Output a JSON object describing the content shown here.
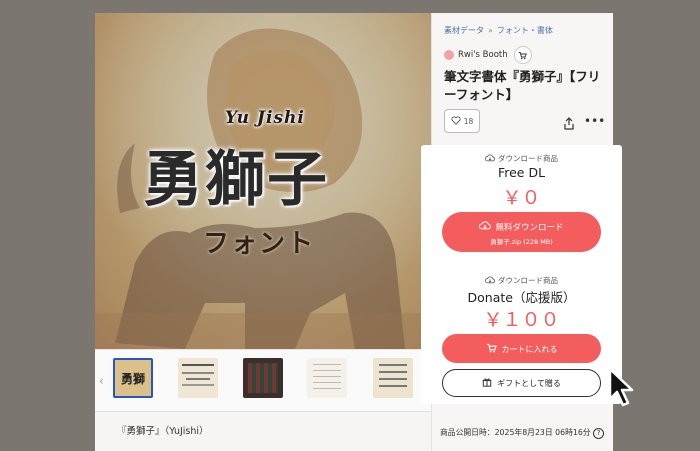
{
  "breadcrumb": {
    "category": "素材データ",
    "separator": "»",
    "subcategory": "フォント・書体"
  },
  "shop": {
    "name": "Rwi's Booth",
    "icon": "cart-icon"
  },
  "product": {
    "title": "筆文字書体『勇獅子』【フリーフォント】",
    "likes": "18",
    "hero": {
      "small_text": "Yu Jishi",
      "main_text": "勇獅子",
      "sub_text": "フォント"
    }
  },
  "plans": [
    {
      "type_label": "ダウンロード商品",
      "name": "Free DL",
      "price": "￥０",
      "button_label": "無料ダウンロード",
      "button_sub": "勇獅子.zip (228 MB)"
    },
    {
      "type_label": "ダウンロード商品",
      "name": "Donate（応援版）",
      "price": "￥１００",
      "button_label": "カートに入れる",
      "gift_label": "ギフトとして贈る"
    }
  ],
  "description": {
    "title": "『勇獅子』（YuJishi）"
  },
  "meta": {
    "published": "商品公開日時：2025年8月23日 06時16分"
  },
  "colors": {
    "accent": "#f45d5d",
    "link": "#4b6fb0",
    "overlay": "#7c7670"
  }
}
